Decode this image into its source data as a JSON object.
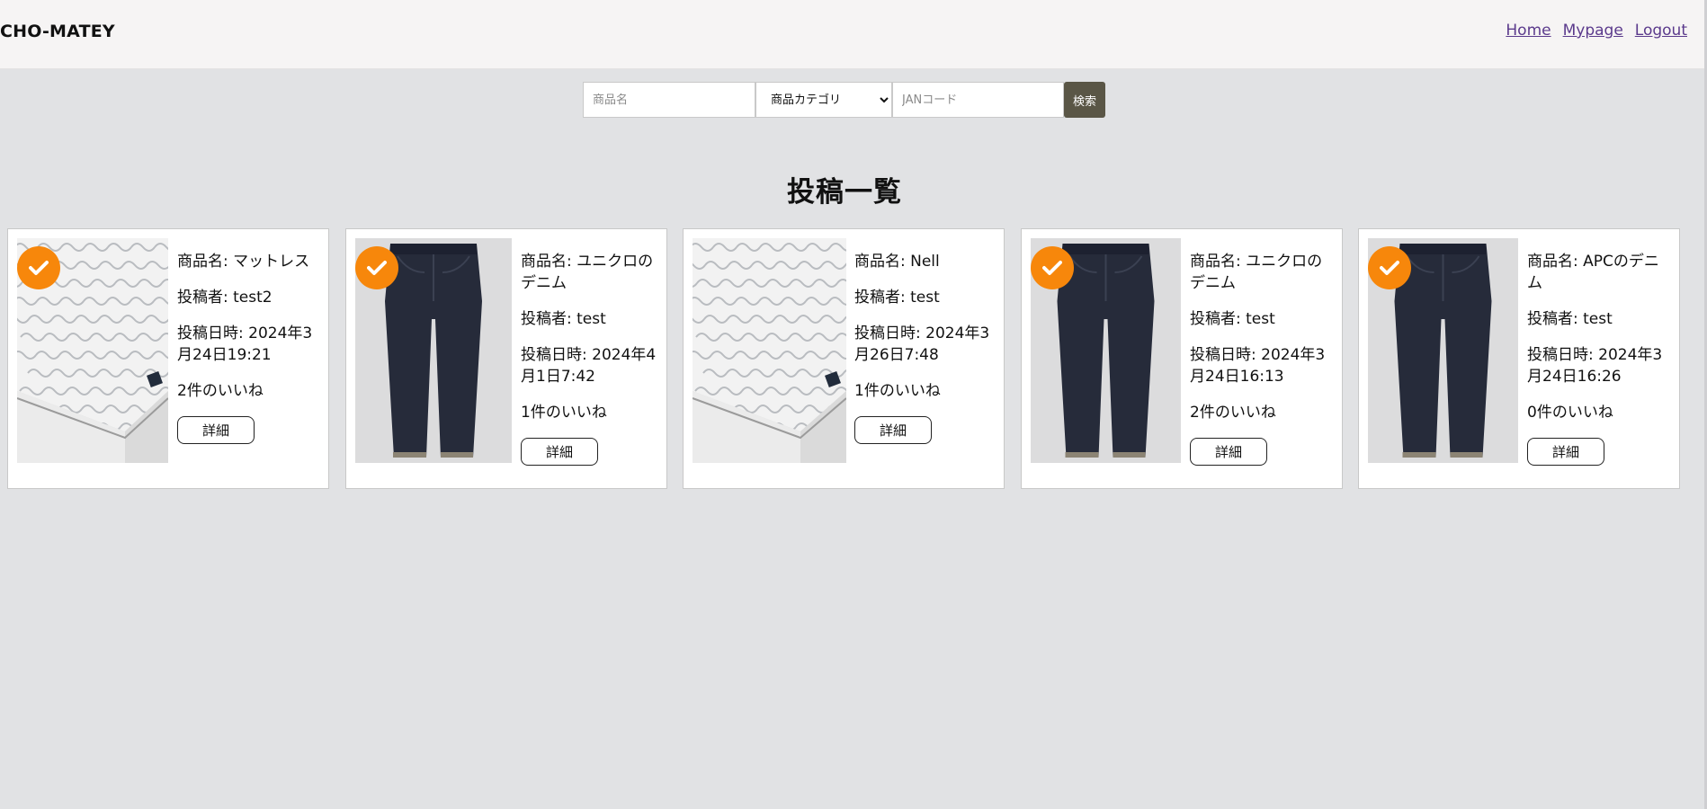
{
  "header": {
    "brand": "CHO-MATEY",
    "nav": [
      "Home",
      "Mypage",
      "Logout"
    ]
  },
  "search": {
    "name_placeholder": "商品名",
    "category_selected": "商品カテゴリ",
    "jan_placeholder": "JANコード",
    "submit_label": "検索"
  },
  "page_title": "投稿一覧",
  "posts": [
    {
      "image": "mattress",
      "liked_badge": true,
      "name_line": "商品名: マットレス",
      "author_line": "投稿者: test2",
      "date_line": "投稿日時: 2024年3月24日19:21",
      "likes_line": "2件のいいね",
      "detail_label": "詳細"
    },
    {
      "image": "jeans",
      "liked_badge": true,
      "name_line": "商品名: ユニクロのデニム",
      "author_line": "投稿者: test",
      "date_line": "投稿日時: 2024年4月1日7:42",
      "likes_line": "1件のいいね",
      "detail_label": "詳細"
    },
    {
      "image": "mattress",
      "liked_badge": false,
      "name_line": "商品名: Nell",
      "author_line": "投稿者: test",
      "date_line": "投稿日時: 2024年3月26日7:48",
      "likes_line": "1件のいいね",
      "detail_label": "詳細"
    },
    {
      "image": "jeans",
      "liked_badge": true,
      "name_line": "商品名: ユニクロのデニム",
      "author_line": "投稿者: test",
      "date_line": "投稿日時: 2024年3月24日16:13",
      "likes_line": "2件のいいね",
      "detail_label": "詳細"
    },
    {
      "image": "jeans",
      "liked_badge": true,
      "name_line": "商品名: APCのデニム",
      "author_line": "投稿者: test",
      "date_line": "投稿日時: 2024年3月24日16:26",
      "likes_line": "0件のいいね",
      "detail_label": "詳細"
    }
  ],
  "colors": {
    "page_bg": "#e1e2e4",
    "header_bg": "#f6f4f4",
    "search_button": "#5a5646",
    "badge": "#f7870b",
    "nav_link": "#5b3a8c"
  }
}
